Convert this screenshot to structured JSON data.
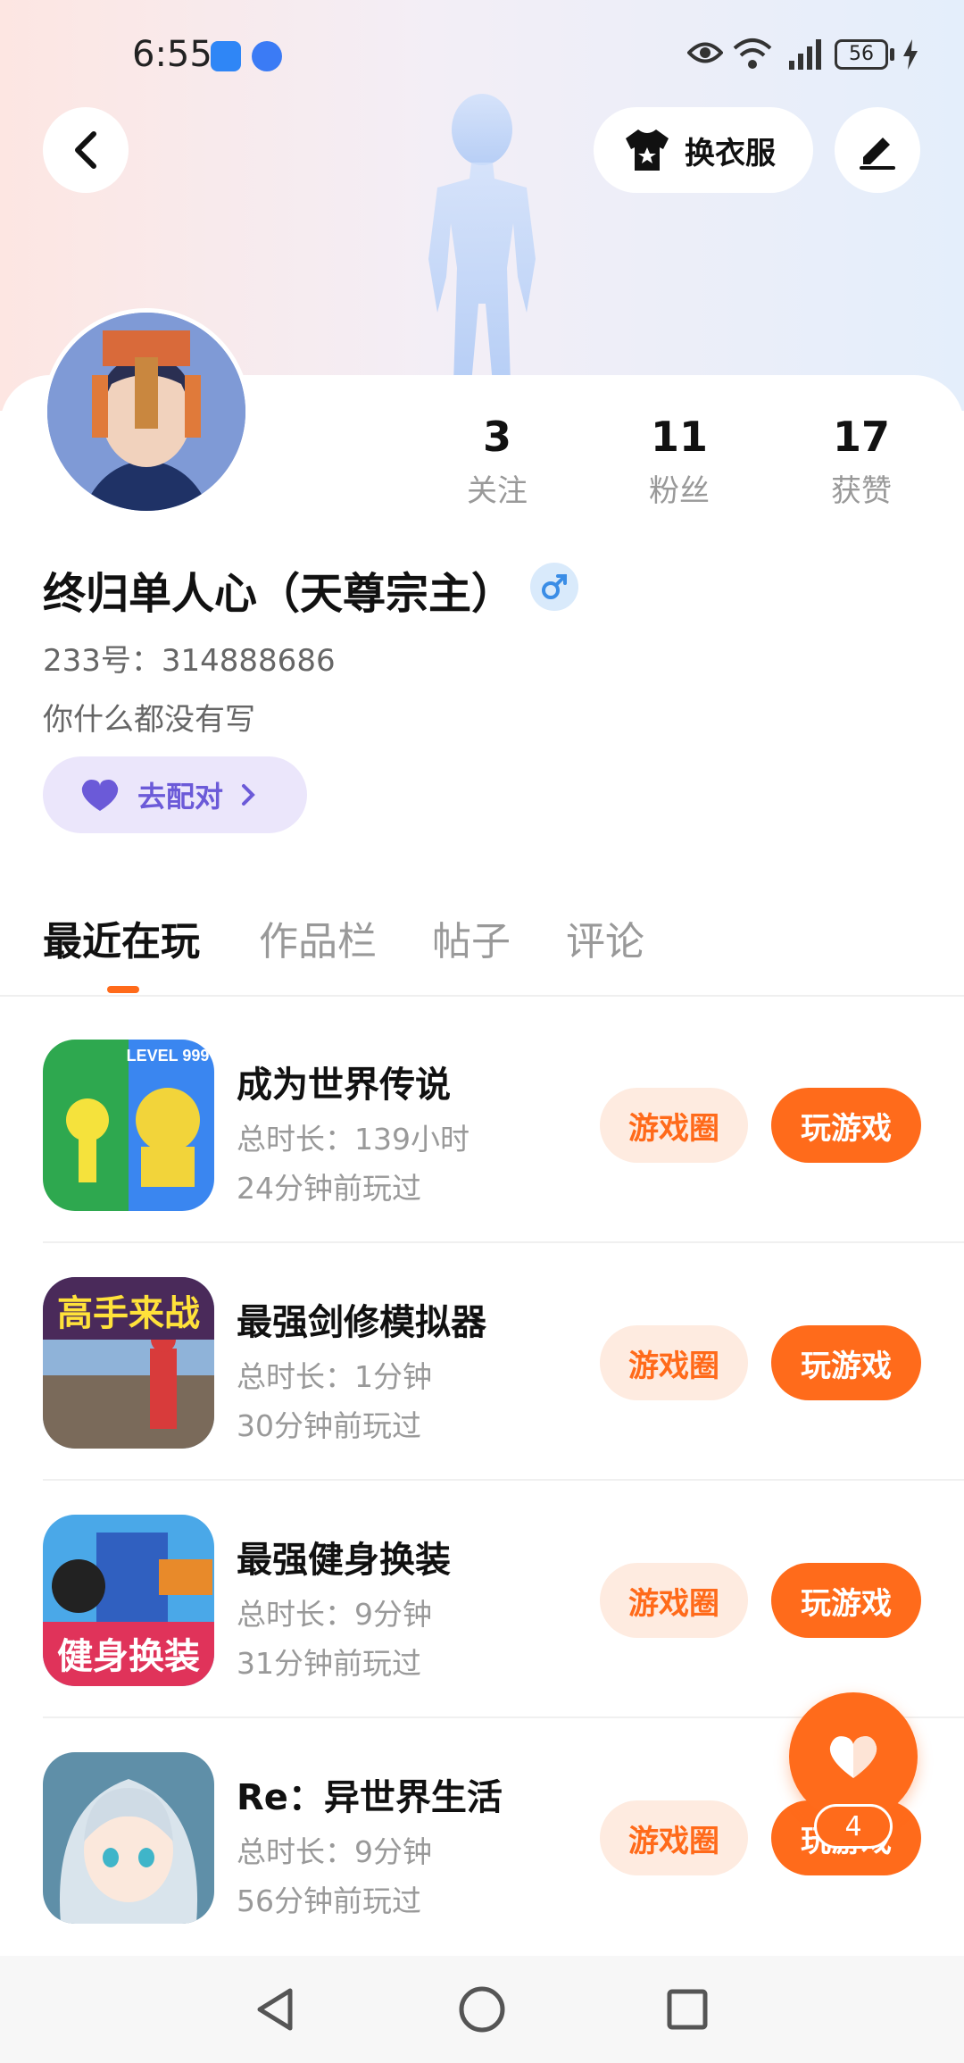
{
  "status_bar": {
    "time": "6:55",
    "battery": "56"
  },
  "header": {
    "outfit_label": "换衣服"
  },
  "stats": [
    {
      "value": "3",
      "label": "关注"
    },
    {
      "value": "11",
      "label": "粉丝"
    },
    {
      "value": "17",
      "label": "获赞"
    }
  ],
  "profile": {
    "username": "终归单人心（天尊宗主）",
    "uid": "233号：314888686",
    "bio": "你什么都没有写",
    "match_label": "去配对"
  },
  "tabs": [
    {
      "label": "最近在玩",
      "active": true
    },
    {
      "label": "作品栏",
      "active": false
    },
    {
      "label": "帖子",
      "active": false
    },
    {
      "label": "评论",
      "active": false
    }
  ],
  "games": [
    {
      "title": "成为世界传说",
      "duration": "总时长：139小时",
      "last_played": "24分钟前玩过",
      "circle_label": "游戏圈",
      "play_label": "玩游戏",
      "icon_text": "LEVEL 999"
    },
    {
      "title": "最强剑修模拟器",
      "duration": "总时长：1分钟",
      "last_played": "30分钟前玩过",
      "circle_label": "游戏圈",
      "play_label": "玩游戏",
      "icon_text": "高手来战"
    },
    {
      "title": "最强健身换装",
      "duration": "总时长：9分钟",
      "last_played": "31分钟前玩过",
      "circle_label": "游戏圈",
      "play_label": "玩游戏",
      "icon_text": "健身换装"
    },
    {
      "title": "Re：异世界生活",
      "duration": "总时长：9分钟",
      "last_played": "56分钟前玩过",
      "circle_label": "游戏圈",
      "play_label": "玩游戏",
      "icon_text": ""
    }
  ],
  "fab": {
    "like_count": "4"
  },
  "colors": {
    "accent": "#ff6b1b",
    "accent_soft": "#feebe0",
    "match_bg": "#ebe6fb",
    "match_text": "#6b5ad8"
  }
}
